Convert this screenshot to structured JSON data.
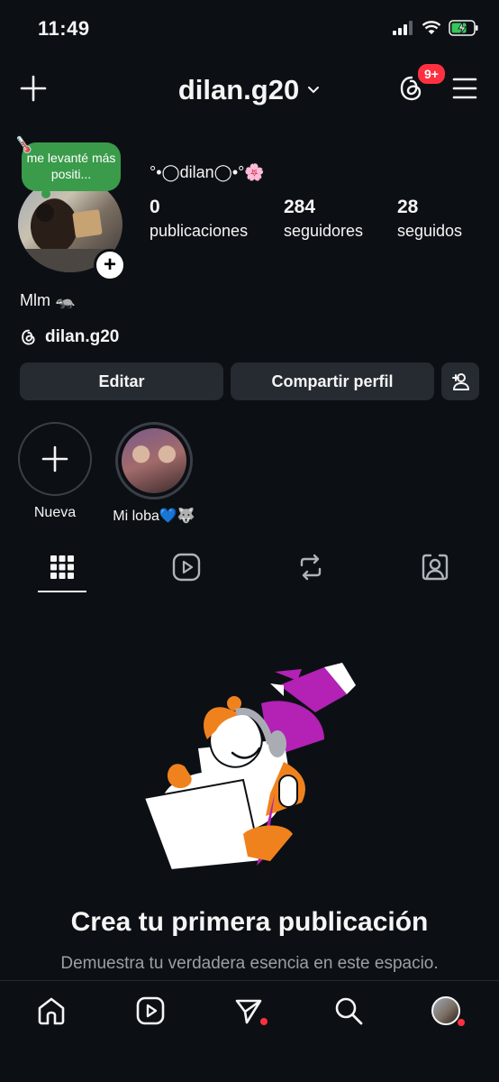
{
  "status_bar": {
    "time": "11:49"
  },
  "header": {
    "username": "dilan.g20",
    "notification_badge": "9+"
  },
  "note": {
    "text": "me levanté más positi..."
  },
  "profile": {
    "display_name": "°•◯dilan◯•°🌸",
    "stats": [
      {
        "value": "0",
        "label": "publicaciones"
      },
      {
        "value": "284",
        "label": "seguidores"
      },
      {
        "value": "28",
        "label": "seguidos"
      }
    ],
    "bio": "Mlm 🦡",
    "threads_handle": "dilan.g20"
  },
  "buttons": {
    "edit": "Editar",
    "share": "Compartir perfil"
  },
  "highlights": [
    {
      "label": "Nueva"
    },
    {
      "label": "Mi loba💙🐺"
    }
  ],
  "tabs": [
    "grid",
    "reels",
    "reposts",
    "tagged"
  ],
  "empty_state": {
    "title": "Crea tu primera publicación",
    "subtitle": "Demuestra tu verdadera esencia en este espacio."
  },
  "colors": {
    "background": "#0c1014",
    "button": "#262a31",
    "badge": "#ff3040",
    "note": "#3a9b4b",
    "illustration_purple": "#b321b5",
    "illustration_orange": "#f0821e"
  }
}
